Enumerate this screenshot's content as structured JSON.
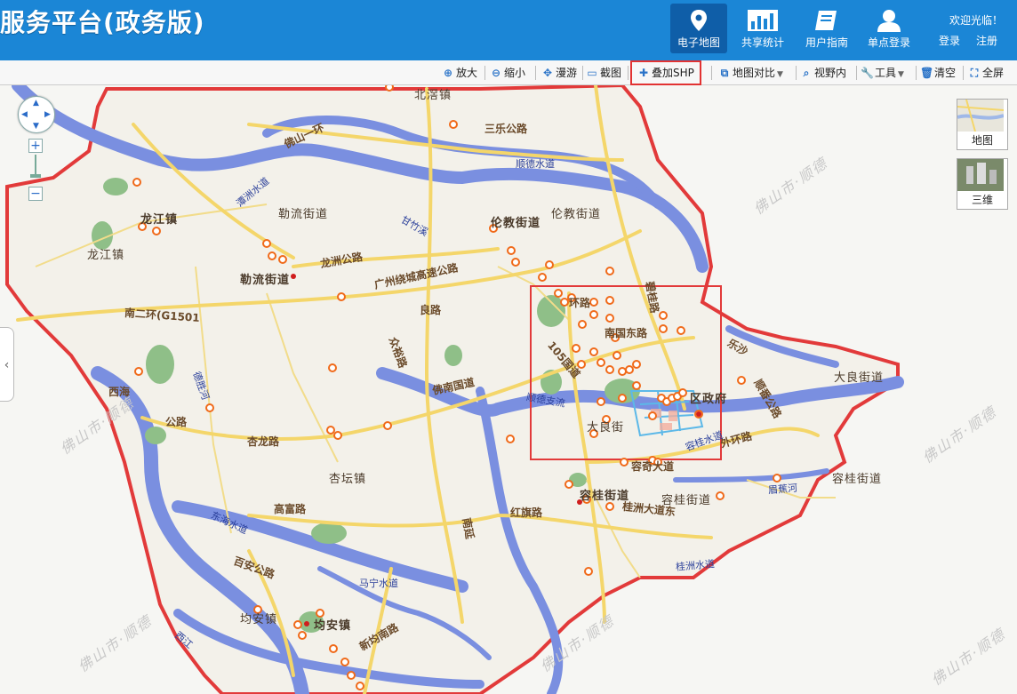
{
  "header": {
    "title": "服务平台(政务版)",
    "nav": [
      {
        "label": "电子地图",
        "icon": "map-pin-icon",
        "active": true
      },
      {
        "label": "共享统计",
        "icon": "bar-chart-icon",
        "active": false
      },
      {
        "label": "用户指南",
        "icon": "book-icon",
        "active": false
      },
      {
        "label": "单点登录",
        "icon": "user-icon",
        "active": false
      }
    ],
    "welcome": "欢迎光临！",
    "login": "登录",
    "register": "注册"
  },
  "toolbar": {
    "items": [
      {
        "label": "放大",
        "icon": "zoom-in-icon"
      },
      {
        "label": "缩小",
        "icon": "zoom-out-icon"
      },
      {
        "label": "漫游",
        "icon": "pan-icon"
      },
      {
        "label": "截图",
        "icon": "screenshot-icon"
      },
      {
        "label": "叠加SHP",
        "icon": "plus-icon"
      },
      {
        "label": "地图对比",
        "icon": "compare-icon"
      },
      {
        "label": "视野内",
        "icon": "search-icon"
      },
      {
        "label": "工具",
        "icon": "wrench-icon"
      },
      {
        "label": "清空",
        "icon": "trash-icon"
      },
      {
        "label": "全屏",
        "icon": "fullscreen-icon"
      }
    ]
  },
  "map": {
    "zoom_in": "+",
    "zoom_out": "−",
    "maptypes": [
      {
        "label": "地图"
      },
      {
        "label": "三维"
      }
    ],
    "places": [
      {
        "name": "北滘镇"
      },
      {
        "name": "勒流街道"
      },
      {
        "name": "伦教街道"
      },
      {
        "name": "龙江镇"
      },
      {
        "name": "龙江镇"
      },
      {
        "name": "伦教街道"
      },
      {
        "name": "勒流街道"
      },
      {
        "name": "大良街道"
      },
      {
        "name": "杏坛镇"
      },
      {
        "name": "容桂街道"
      },
      {
        "name": "容桂街道"
      },
      {
        "name": "容桂街道"
      },
      {
        "name": "均安镇"
      },
      {
        "name": "均安镇"
      },
      {
        "name": "区政府"
      },
      {
        "name": "大良街"
      }
    ],
    "roads": [
      {
        "name": "三乐公路"
      },
      {
        "name": "佛山一环"
      },
      {
        "name": "龙洲公路"
      },
      {
        "name": "广州绕城高速公路"
      },
      {
        "name": "南二环(G1501"
      },
      {
        "name": "佛南国道"
      },
      {
        "name": "杏龙路"
      },
      {
        "name": "高富路"
      },
      {
        "name": "红旗路"
      },
      {
        "name": "桂洲大道东"
      },
      {
        "name": "百安公路"
      },
      {
        "name": "新均南路"
      },
      {
        "name": "顺番公路"
      },
      {
        "name": "碧桂路"
      },
      {
        "name": "南国东路"
      },
      {
        "name": "105国道"
      },
      {
        "name": "容奇大道"
      },
      {
        "name": "外环路"
      },
      {
        "name": "南延"
      },
      {
        "name": "环路"
      },
      {
        "name": "良路"
      },
      {
        "name": "众裕路"
      },
      {
        "name": "乐沙"
      },
      {
        "name": "西海"
      },
      {
        "name": "公路"
      }
    ],
    "waters": [
      {
        "name": "顺德水道"
      },
      {
        "name": "潭洲水道"
      },
      {
        "name": "东海水道"
      },
      {
        "name": "甘竹溪"
      },
      {
        "name": "眉蕉河"
      },
      {
        "name": "桂洲水道"
      },
      {
        "name": "容桂水道"
      },
      {
        "name": "德胜河"
      },
      {
        "name": "马宁水道"
      },
      {
        "name": "西江"
      },
      {
        "name": "顺德支流"
      }
    ],
    "watermark": "佛山市·顺德",
    "colors": {
      "water": "#7a8fe0",
      "boundary": "#e23a3a",
      "major_road": "#f4d66a",
      "poi": "#f06a1a",
      "land": "#f3f1ea",
      "header": "#1b86d6"
    }
  }
}
